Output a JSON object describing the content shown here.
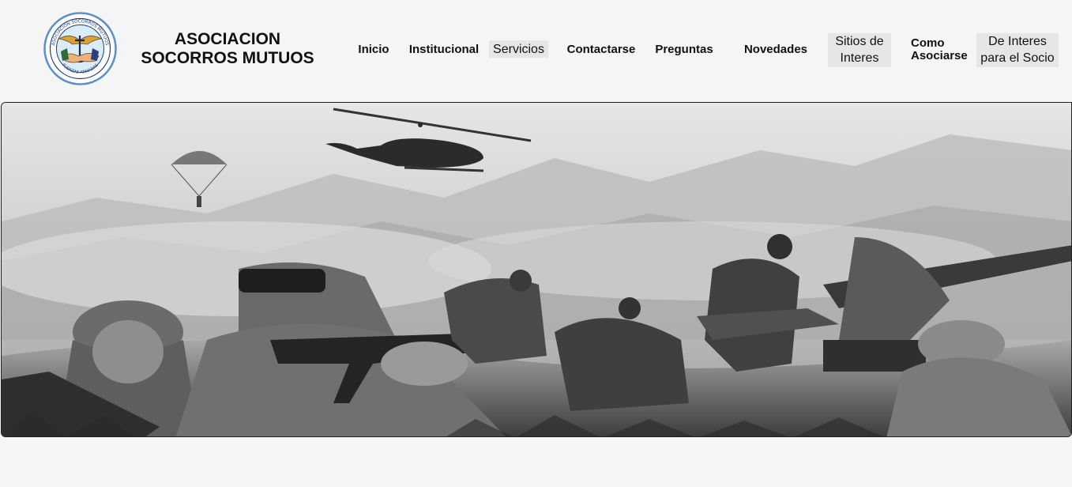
{
  "brand": {
    "line1": "ASOCIACION",
    "line2": "SOCORROS MUTUOS",
    "logo_top_text": "ASOCIACIÓN SOCORROS MUTUOS",
    "logo_bottom_text": "FUERZAS ARMADAS"
  },
  "nav": {
    "inicio": "Inicio",
    "institucional": "Institucional",
    "servicios": "Servicios",
    "contactarse": "Contactarse",
    "preguntas": "Preguntas",
    "novedades": "Novedades",
    "sitios_1": "Sitios de",
    "sitios_2": "Interes",
    "como_1": "Como",
    "como_2": "Asociarse",
    "deinteres_1": "De Interes",
    "deinteres_2": "para el Socio"
  },
  "colors": {
    "background": "#f5f5f5",
    "nav_highlight": "#e6e6e6",
    "logo_ring": "#4a7fc1"
  },
  "icons": {
    "logo": "emblem-handshake-anchor-wings-icon",
    "hero": "military-scene-image"
  }
}
